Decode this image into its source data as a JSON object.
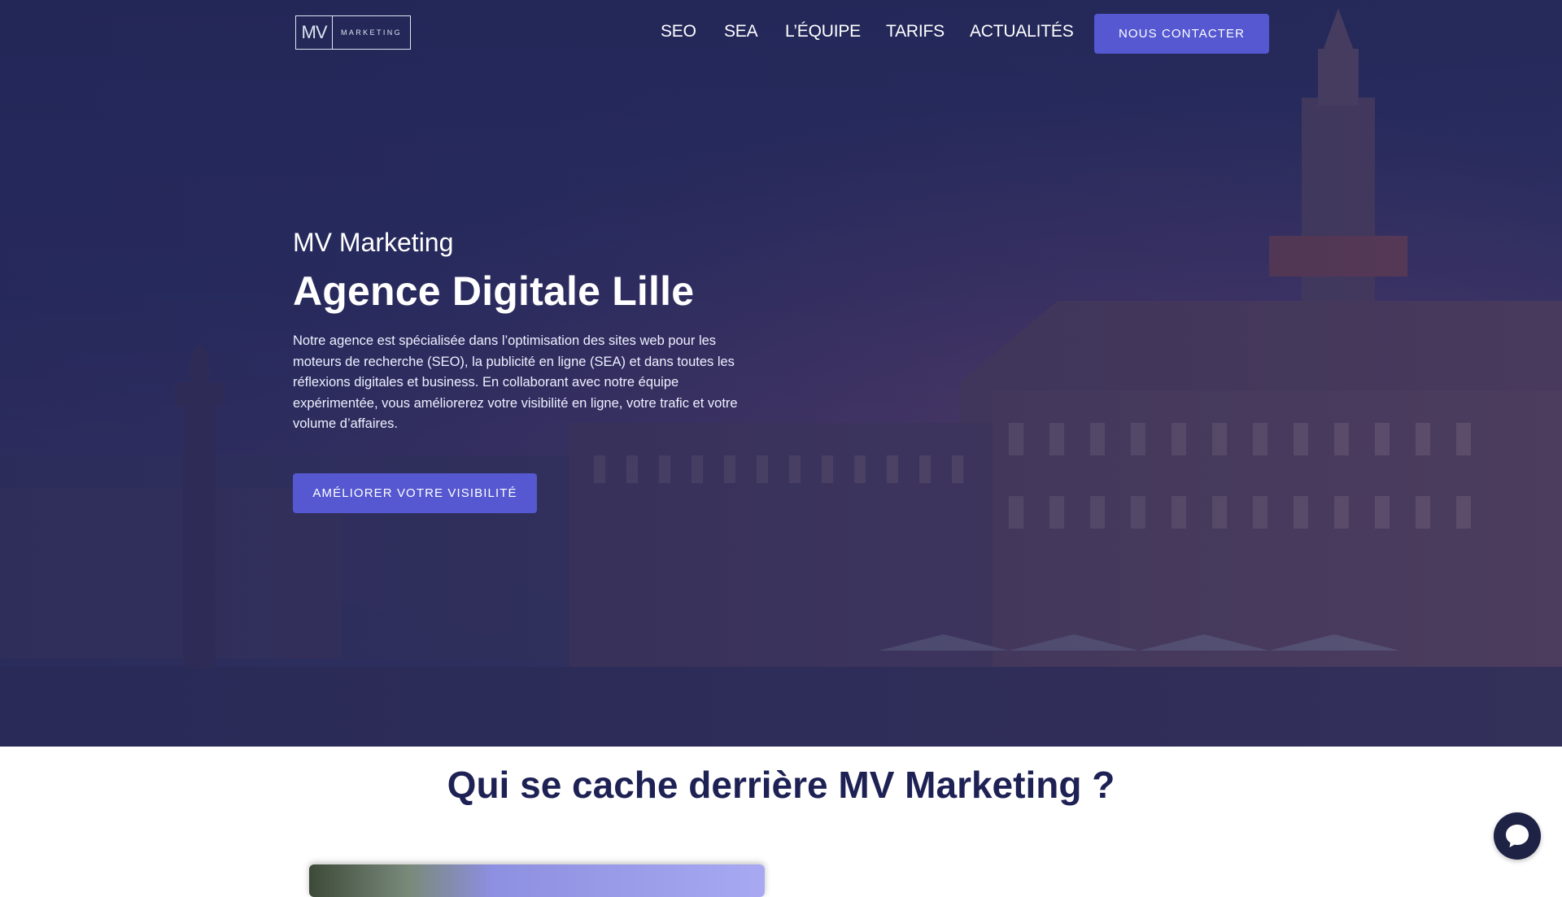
{
  "header": {
    "logo": {
      "mv": "MV",
      "word": "MARKETING"
    },
    "nav": [
      {
        "label": "SEO"
      },
      {
        "label": "SEA"
      },
      {
        "label": "L’ÉQUIPE"
      },
      {
        "label": "TARIFS"
      },
      {
        "label": "ACTUALITÉS"
      }
    ],
    "contact_button": "NOUS CONTACTER"
  },
  "hero": {
    "eyebrow": "MV Marketing",
    "headline": "Agence Digitale Lille",
    "description": "Notre agence est spécialisée dans l’optimisation des sites web pour les moteurs de recherche (SEO), la publicité en ligne (SEA) et dans toutes les réflexions digitales et business. En collaborant avec notre équipe expérimentée, vous améliorerez votre visibilité en ligne, votre trafic et votre volume d’affaires.",
    "cta": "AMÉLIORER VOTRE VISIBILITÉ"
  },
  "about": {
    "title": "Qui se cache derrière MV Marketing ?"
  },
  "chat": {
    "icon": "chat-bubble-icon"
  },
  "colors": {
    "accent": "#5558d0",
    "title_dark": "#1e2154",
    "hero_overlay": "#2c2e62"
  }
}
